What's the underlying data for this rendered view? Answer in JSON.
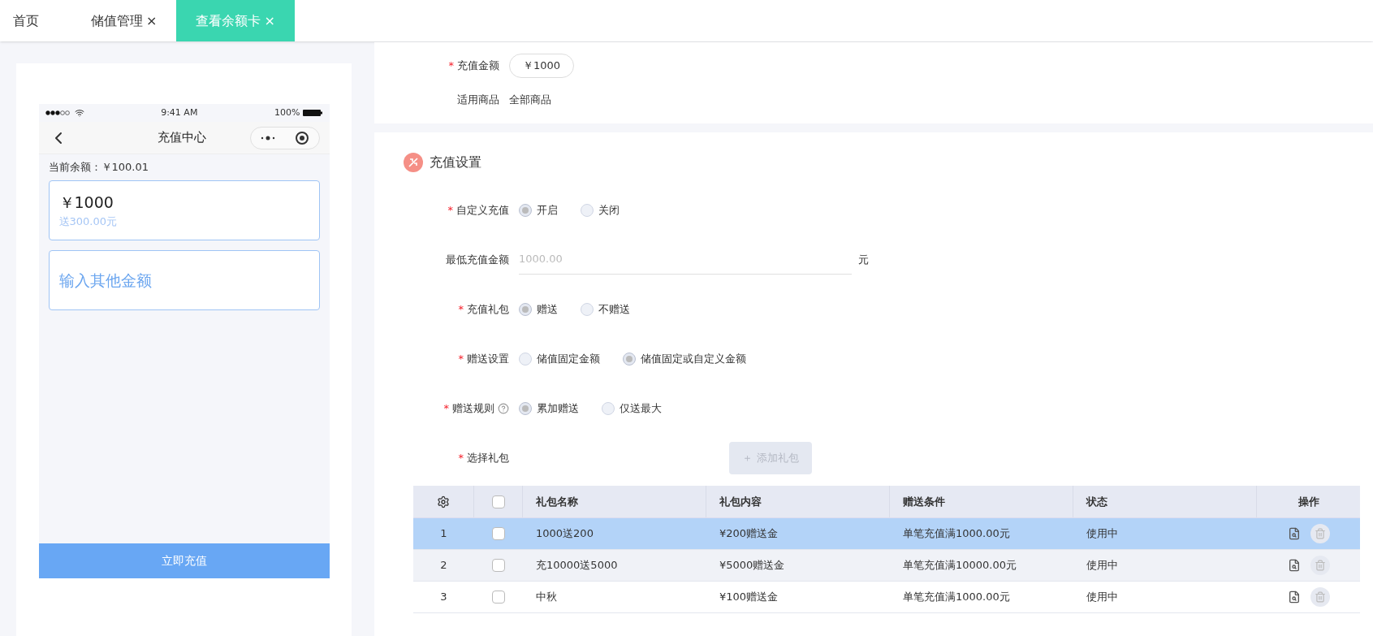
{
  "tabs": [
    {
      "label": "首页",
      "closable": false,
      "selected": false
    },
    {
      "label": "储值管理",
      "closable": true,
      "selected": false
    },
    {
      "label": "查看余额卡",
      "closable": true,
      "selected": true
    }
  ],
  "close_glyph": "×",
  "required_mark": "*",
  "phone": {
    "status": {
      "time": "9:41 AM",
      "battery": "100%"
    },
    "title": "充值中心",
    "balance": "当前余额：￥100.01",
    "options": [
      {
        "kind": "amount",
        "amount": "￥1000",
        "bonus": "送300.00元"
      },
      {
        "kind": "custom",
        "placeholder": "输入其他金额"
      }
    ],
    "button": "立即充值"
  },
  "top_fields": [
    {
      "label": "充值金额",
      "required": true,
      "kind": "pill",
      "value": "￥1000"
    },
    {
      "label": "适用商品",
      "required": false,
      "kind": "text",
      "value": "全部商品"
    }
  ],
  "section_title": "充值设置",
  "settings": [
    {
      "label": "自定义充值",
      "required": true,
      "kind": "radio",
      "options": [
        {
          "label": "开启",
          "selected": true
        },
        {
          "label": "关闭",
          "selected": false
        }
      ]
    },
    {
      "label": "最低充值金额",
      "required": false,
      "kind": "input",
      "placeholder": "1000.00",
      "unit": "元"
    },
    {
      "label": "充值礼包",
      "required": true,
      "kind": "radio",
      "options": [
        {
          "label": "赠送",
          "selected": true
        },
        {
          "label": "不赠送",
          "selected": false
        }
      ]
    },
    {
      "label": "赠送设置",
      "required": true,
      "kind": "radio",
      "options": [
        {
          "label": "储值固定金额",
          "selected": false
        },
        {
          "label": "储值固定或自定义金额",
          "selected": true
        }
      ]
    },
    {
      "label": "赠送规则",
      "required": true,
      "kind": "radio",
      "help": true,
      "options": [
        {
          "label": "累加赠送",
          "selected": true
        },
        {
          "label": "仅送最大",
          "selected": false
        }
      ]
    },
    {
      "label": "选择礼包",
      "required": true,
      "kind": "button",
      "button": "＋ 添加礼包",
      "disabled": true
    }
  ],
  "table": {
    "all_checked": false,
    "columns": [
      "礼包名称",
      "礼包内容",
      "赠送条件",
      "状态",
      "操作"
    ],
    "rows": [
      {
        "index": "1",
        "checked": false,
        "selected": true,
        "cells": [
          "1000送200",
          "¥200赠送金",
          "单笔充值满1000.00元",
          "使用中"
        ]
      },
      {
        "index": "2",
        "checked": false,
        "selected": false,
        "cells": [
          "充10000送5000",
          "¥5000赠送金",
          "单笔充值满10000.00元",
          "使用中"
        ]
      },
      {
        "index": "3",
        "checked": false,
        "selected": false,
        "cells": [
          "中秋",
          "¥100赠送金",
          "单笔充值满1000.00元",
          "使用中"
        ]
      }
    ]
  }
}
